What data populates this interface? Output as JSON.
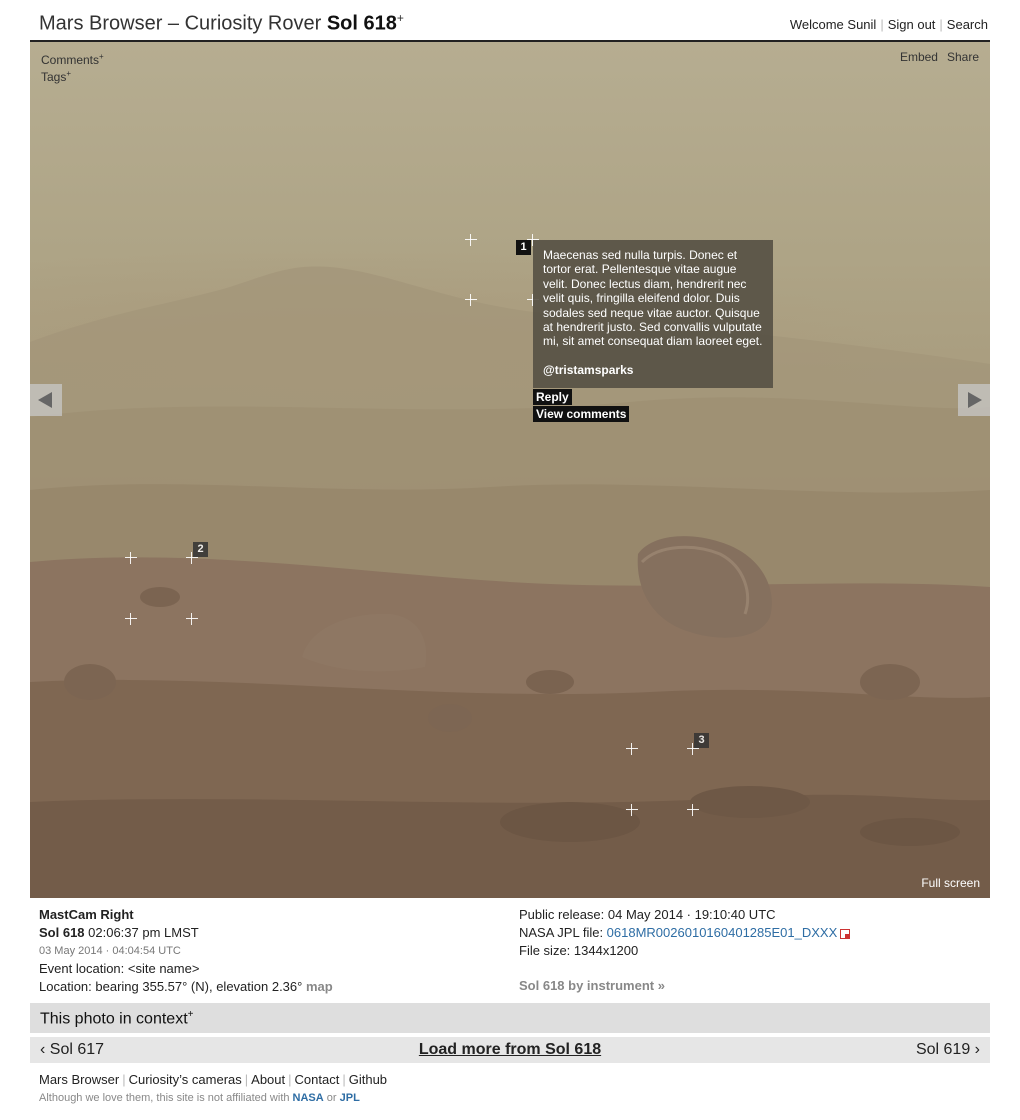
{
  "header": {
    "title_prefix": "Mars Browser – Curiosity Rover ",
    "title_sol": "Sol 618",
    "title_sup": "+",
    "nav": {
      "welcome": "Welcome Sunil",
      "sign_out": "Sign out",
      "search": "Search"
    }
  },
  "photo": {
    "comments_label": "Comments",
    "comments_sup": "+",
    "tags_label": "Tags",
    "tags_sup": "+",
    "embed": "Embed",
    "share": "Share",
    "full_screen": "Full screen",
    "annotations": [
      {
        "number": "1",
        "text": "Maecenas sed nulla turpis. Donec et tortor erat. Pellentesque vitae augue velit. Donec lectus diam, hendrerit nec velit quis, fringilla eleifend dolor. Duis sodales sed neque vitae auctor. Quisque at hendrerit justo. Sed convallis vulputate mi, sit amet consequat diam laoreet eget.",
        "author": "@tristamsparks",
        "reply": "Reply",
        "view_comments": "View comments"
      },
      {
        "number": "2"
      },
      {
        "number": "3"
      }
    ]
  },
  "meta": {
    "instrument": "MastCam Right",
    "sol_label": "Sol 618",
    "sol_time": " 02:06:37 pm LMST",
    "earth_date": "03 May 2014 · 04:04:54 UTC",
    "event_location": "Event location: <site name>",
    "location": "Location: bearing 355.57° (N), elevation 2.36°",
    "map_link": "map",
    "public_release": "Public release: 04 May 2014 · 19:10:40 UTC",
    "jpl_label": "NASA JPL file: ",
    "jpl_file": "0618MR0026010160401285E01_DXXX",
    "file_size": "File size: 1344x1200",
    "by_instrument": "Sol 618 by instrument",
    "by_instrument_arrow": "»"
  },
  "context": {
    "label": "This photo in context",
    "sup": "+"
  },
  "pager": {
    "prev": "‹ Sol 617",
    "load_more": "Load more from Sol 618",
    "next": "Sol 619 ›"
  },
  "footer": {
    "links": [
      "Mars Browser",
      "Curiosity’s cameras",
      "About",
      "Contact",
      "Github"
    ],
    "note_prefix": "Although we love them, this site is not affiliated with ",
    "nasa": "NASA",
    "or": " or ",
    "jpl": "JPL"
  }
}
